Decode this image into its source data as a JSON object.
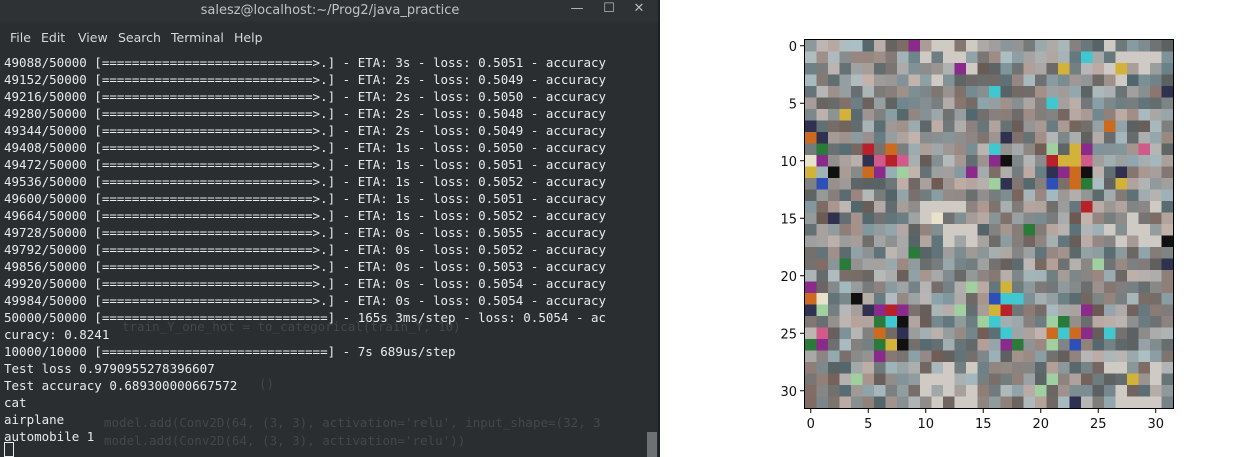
{
  "terminal": {
    "title": "salesz@localhost:~/Prog2/java_practice",
    "window_buttons": {
      "minimize": "—",
      "maximize": "☐",
      "close": "✕"
    },
    "menu": [
      "File",
      "Edit",
      "View",
      "Search",
      "Terminal",
      "Help"
    ],
    "lines": [
      "49088/50000 [============================>.] - ETA: 3s - loss: 0.5051 - accuracy",
      "49152/50000 [============================>.] - ETA: 2s - loss: 0.5049 - accuracy",
      "49216/50000 [============================>.] - ETA: 2s - loss: 0.5050 - accuracy",
      "49280/50000 [============================>.] - ETA: 2s - loss: 0.5048 - accuracy",
      "49344/50000 [============================>.] - ETA: 2s - loss: 0.5049 - accuracy",
      "49408/50000 [============================>.] - ETA: 1s - loss: 0.5050 - accuracy",
      "49472/50000 [============================>.] - ETA: 1s - loss: 0.5051 - accuracy",
      "49536/50000 [============================>.] - ETA: 1s - loss: 0.5052 - accuracy",
      "49600/50000 [============================>.] - ETA: 1s - loss: 0.5051 - accuracy",
      "49664/50000 [============================>.] - ETA: 1s - loss: 0.5052 - accuracy",
      "49728/50000 [============================>.] - ETA: 0s - loss: 0.5055 - accuracy",
      "49792/50000 [============================>.] - ETA: 0s - loss: 0.5052 - accuracy",
      "49856/50000 [============================>.] - ETA: 0s - loss: 0.5053 - accuracy",
      "49920/50000 [============================>.] - ETA: 0s - loss: 0.5054 - accuracy",
      "49984/50000 [============================>.] - ETA: 0s - loss: 0.5054 - accuracy",
      "50000/50000 [==============================] - 165s 3ms/step - loss: 0.5054 - ac",
      "curacy: 0.8241",
      "10000/10000 [==============================] - 7s 689us/step",
      "Test loss 0.9790955278396607",
      "Test accuracy 0.689300000667572",
      "cat",
      "airplane",
      "automobile 1"
    ],
    "background_ghost_text": [
      "train_Y_one_hot = to_categorical(train_Y, 10)",
      "()",
      "model.add(Conv2D(64, (3, 3), activation='relu', input_shape=(32, 3",
      "model.add(Conv2D(64, (3, 3), activation='relu'))"
    ]
  },
  "plot": {
    "x_ticks": [
      "0",
      "5",
      "10",
      "15",
      "20",
      "25",
      "30"
    ],
    "y_ticks": [
      "0",
      "5",
      "10",
      "15",
      "20",
      "25",
      "30"
    ],
    "image_size": 32,
    "description_colors": [
      "#7a7770",
      "#5d5b59",
      "#8a8a84",
      "#6f8a7a",
      "#6e6678"
    ]
  }
}
